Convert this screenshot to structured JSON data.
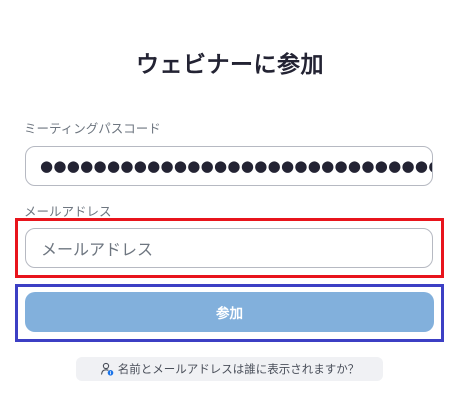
{
  "page": {
    "title": "ウェビナーに参加"
  },
  "passcode": {
    "label": "ミーティングパスコード",
    "value_masked": "●●●●●●●●●●●●●●●●●●●●●●●●●●●●●●●"
  },
  "email": {
    "label": "メールアドレス",
    "placeholder": "メールアドレス"
  },
  "actions": {
    "join_label": "参加"
  },
  "info": {
    "text": "名前とメールアドレスは誰に表示されますか？",
    "icon": "person-info-icon"
  },
  "colors": {
    "button_disabled": "#82b0dc",
    "highlight_email": "#e8141c",
    "highlight_button": "#3c3fc4",
    "info_icon_accent": "#1a73e8"
  }
}
